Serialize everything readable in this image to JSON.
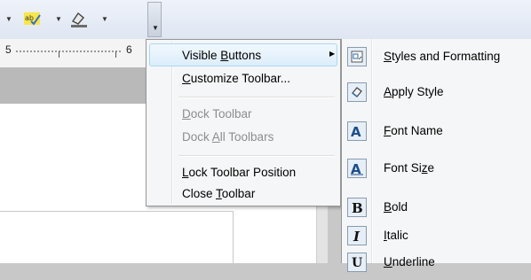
{
  "colors": {
    "highlight_border": "#a8d8f5",
    "highlight_fill": "#dcedfb",
    "disabled_text": "#8d8d8d",
    "icon_blue": "#1c4f8a"
  },
  "ruler": {
    "left_number": "5",
    "right_number": "6"
  },
  "toolbar": {
    "icons": [
      "dropdown-arrow",
      "spellcheck-icon",
      "dropdown-arrow",
      "highlight-icon",
      "dropdown-arrow"
    ]
  },
  "menu": {
    "items": [
      {
        "pre": "Visible ",
        "key": "B",
        "post": "uttons",
        "enabled": true,
        "has_submenu": true
      },
      {
        "pre": "",
        "key": "C",
        "post": "ustomize Toolbar...",
        "enabled": true
      },
      {
        "pre": "",
        "key": "D",
        "post": "ock Toolbar",
        "enabled": false
      },
      {
        "pre": "Dock ",
        "key": "A",
        "post": "ll Toolbars",
        "enabled": false
      },
      {
        "pre": "",
        "key": "L",
        "post": "ock Toolbar Position",
        "enabled": true
      },
      {
        "pre": "Close ",
        "key": "T",
        "post": "oolbar",
        "enabled": true
      }
    ]
  },
  "submenu": {
    "items": [
      {
        "icon": "styles-formatting-icon",
        "pre": "",
        "key": "S",
        "post": "tyles and Formatting"
      },
      {
        "icon": "apply-style-icon",
        "pre": "",
        "key": "A",
        "post": "pply Style"
      },
      {
        "icon": "font-name-icon",
        "pre": "",
        "key": "F",
        "post": "ont Name"
      },
      {
        "icon": "font-size-icon",
        "pre": "Font Si",
        "key": "z",
        "post": "e"
      },
      {
        "icon": "bold-icon",
        "pre": "",
        "key": "B",
        "post": "old"
      },
      {
        "icon": "italic-icon",
        "pre": "",
        "key": "I",
        "post": "talic"
      },
      {
        "icon": "underline-icon",
        "pre": "",
        "key": "U",
        "post": "nderline"
      }
    ]
  }
}
